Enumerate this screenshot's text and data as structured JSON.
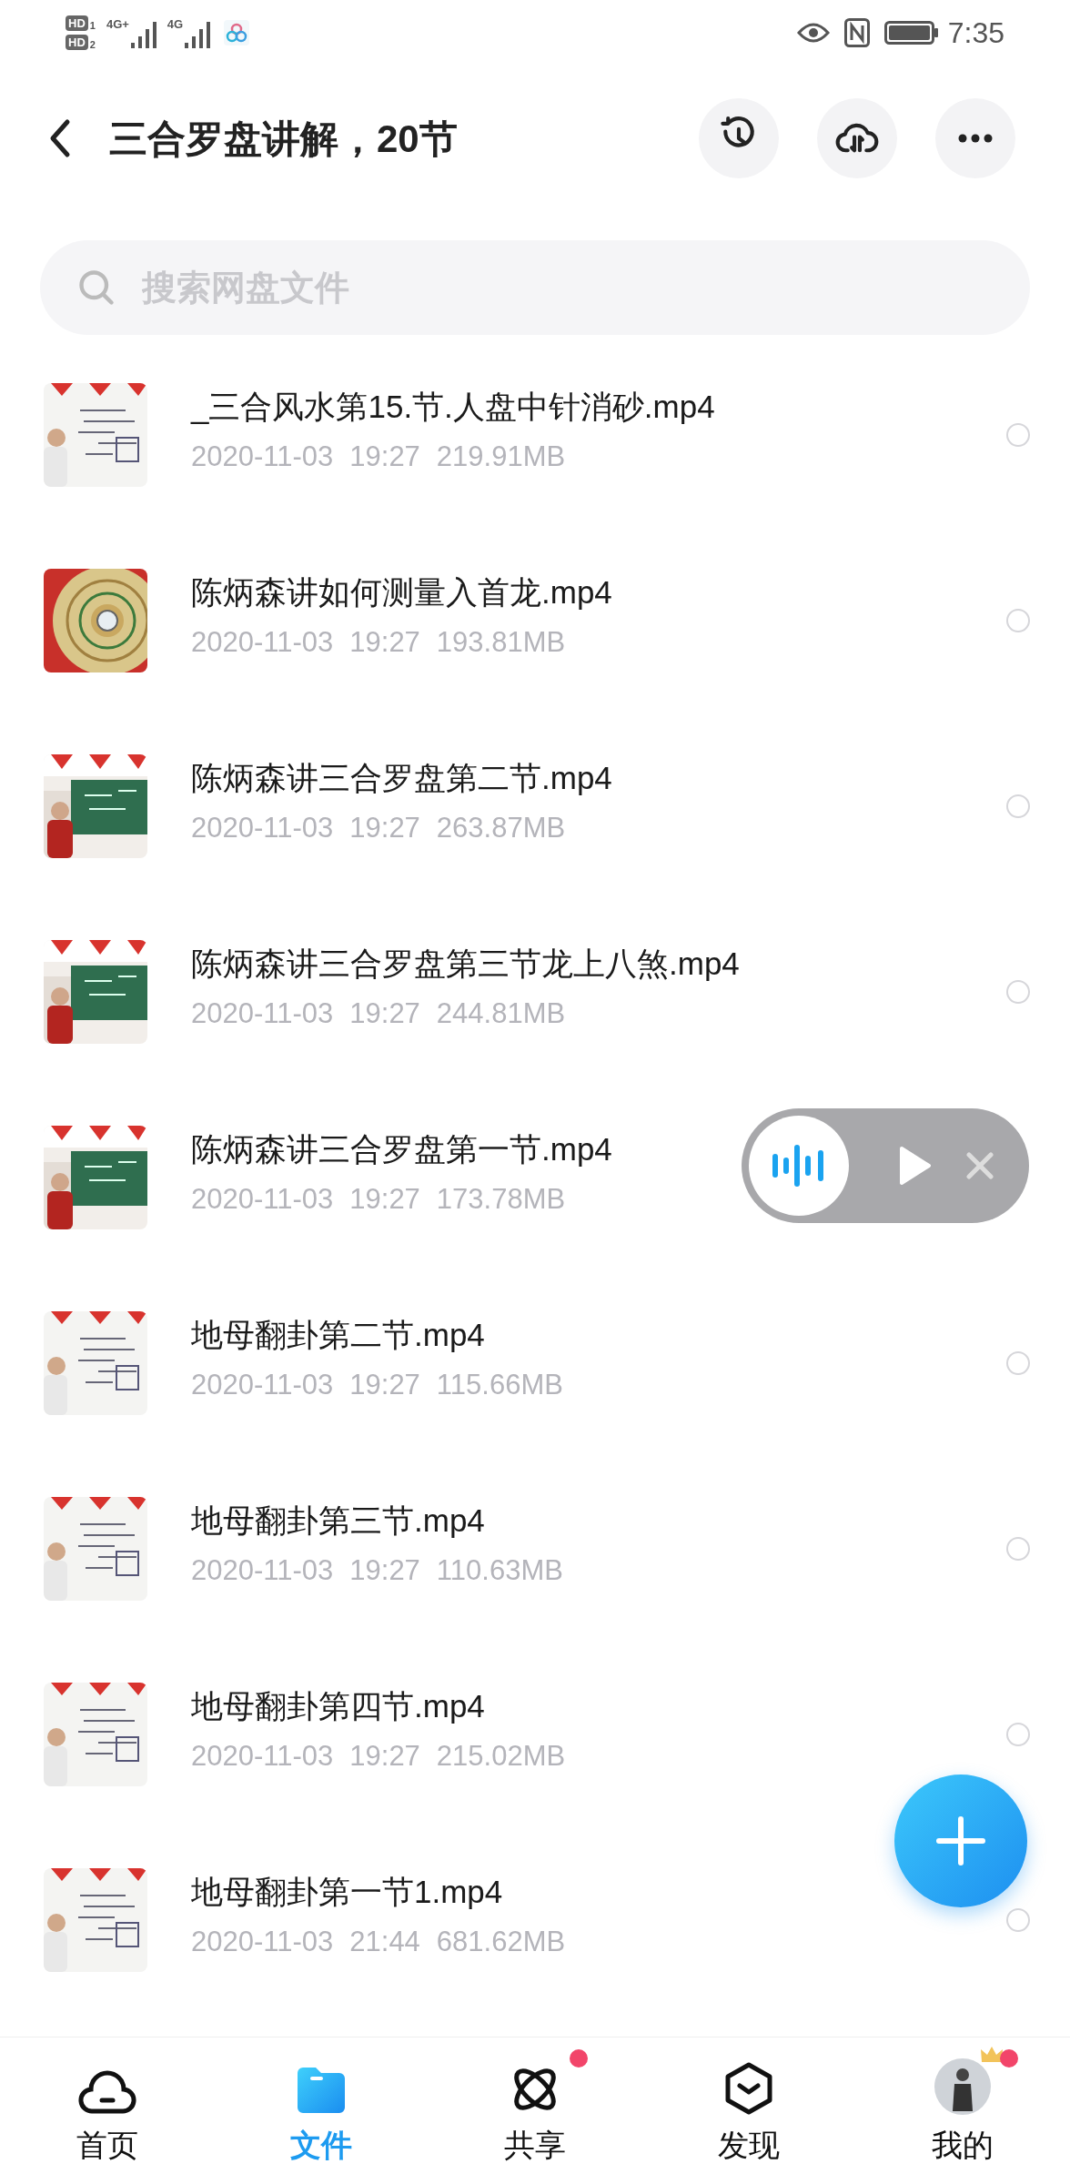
{
  "status_bar": {
    "sim1": {
      "label": "HD",
      "slot": "1"
    },
    "sim2": {
      "label": "HD",
      "slot": "2"
    },
    "net1": "4G+",
    "net2": "4G",
    "time": "7:35"
  },
  "header": {
    "title": "三合罗盘讲解，20节"
  },
  "search": {
    "placeholder": "搜索网盘文件"
  },
  "files": [
    {
      "name": "_三合风水第15.节.人盘中针消砂.mp4",
      "date": "2020-11-03",
      "time": "19:27",
      "size": "219.91MB",
      "selected": false
    },
    {
      "name": "陈炳森讲如何测量入首龙.mp4",
      "date": "2020-11-03",
      "time": "19:27",
      "size": "193.81MB",
      "selected": false
    },
    {
      "name": "陈炳森讲三合罗盘第二节.mp4",
      "date": "2020-11-03",
      "time": "19:27",
      "size": "263.87MB",
      "selected": false
    },
    {
      "name": "陈炳森讲三合罗盘第三节龙上八煞.mp4",
      "date": "2020-11-03",
      "time": "19:27",
      "size": "244.81MB",
      "selected": false
    },
    {
      "name": "陈炳森讲三合罗盘第一节.mp4",
      "date": "2020-11-03",
      "time": "19:27",
      "size": "173.78MB"
    },
    {
      "name": "地母翻卦第二节.mp4",
      "date": "2020-11-03",
      "time": "19:27",
      "size": "115.66MB",
      "selected": false
    },
    {
      "name": "地母翻卦第三节.mp4",
      "date": "2020-11-03",
      "time": "19:27",
      "size": "110.63MB",
      "selected": false
    },
    {
      "name": "地母翻卦第四节.mp4",
      "date": "2020-11-03",
      "time": "19:27",
      "size": "215.02MB",
      "selected": false
    },
    {
      "name": "地母翻卦第一节1.mp4",
      "date": "2020-11-03",
      "time": "21:44",
      "size": "681.62MB",
      "selected": false
    }
  ],
  "nav": [
    {
      "label": "首页",
      "kind": "home",
      "selected": false,
      "badge": false
    },
    {
      "label": "文件",
      "kind": "files",
      "selected": true,
      "badge": false
    },
    {
      "label": "共享",
      "kind": "share",
      "selected": false,
      "badge": true
    },
    {
      "label": "发现",
      "kind": "discover",
      "selected": false,
      "badge": false
    },
    {
      "label": "我的",
      "kind": "me",
      "selected": false,
      "badge": true
    }
  ]
}
